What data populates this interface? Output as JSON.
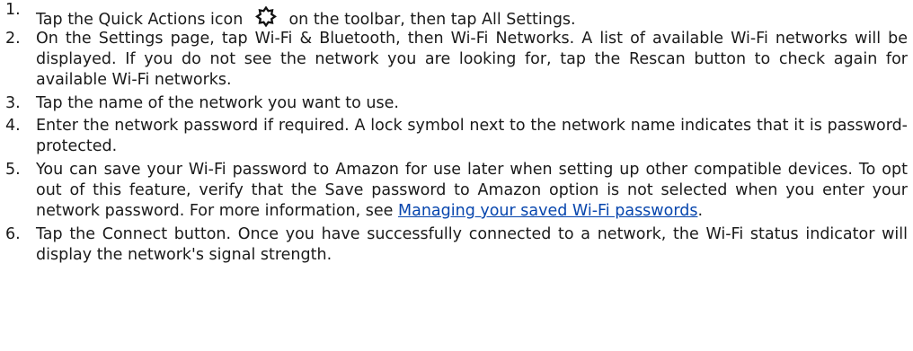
{
  "steps": [
    {
      "number": "1.",
      "before_icon": "Tap the Quick Actions icon",
      "icon": "gear-icon",
      "after_icon": "on the toolbar, then tap All Settings."
    },
    {
      "number": "2.",
      "text": "On the Settings page, tap Wi-Fi & Bluetooth, then Wi-Fi Networks. A list of available Wi-Fi networks will be displayed. If you do not see the network you are looking for, tap the Rescan button to check again for available Wi-Fi networks."
    },
    {
      "number": "3.",
      "text": "Tap the name of the network you want to use."
    },
    {
      "number": "4.",
      "text": "Enter the network password if required. A lock symbol next to the network name indicates that it is password-protected."
    },
    {
      "number": "5.",
      "text": "You can save your Wi-Fi password to Amazon for use later when setting up other compatible devices. To opt out of this feature, verify that the Save password to Amazon option is not selected when you enter your network password. For more information, see",
      "link": "Managing your saved Wi-Fi passwords",
      "after_link": "."
    },
    {
      "number": "6.",
      "text": "Tap the Connect button. Once you have successfully connected to a network, the Wi-Fi status indicator will display the network's signal strength."
    }
  ],
  "colors": {
    "text": "#1a1a1a",
    "link": "#0645ad"
  }
}
